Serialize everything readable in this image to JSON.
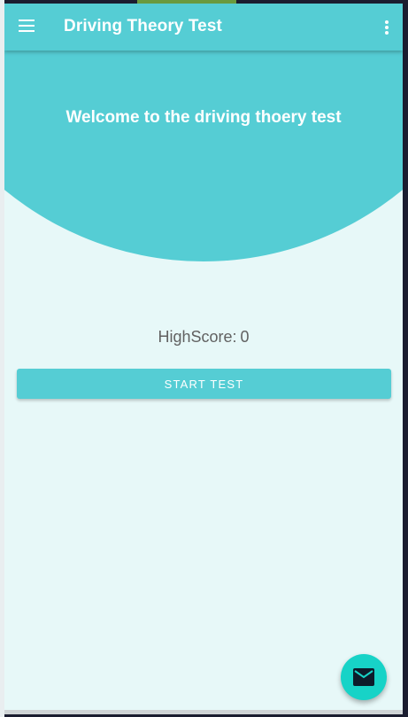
{
  "app_bar": {
    "title": "Driving Theory Test",
    "menu_icon": "hamburger-menu-icon",
    "overflow_icon": "more-vert-icon",
    "background": "#55cdd4"
  },
  "hero": {
    "welcome_text": "Welcome to the driving thoery test",
    "background": "#55cdd4"
  },
  "score": {
    "label": "HighScore:",
    "value": "0"
  },
  "actions": {
    "start_label": "START TEST"
  },
  "fab": {
    "icon": "mail-icon",
    "color": "#17d3c7"
  },
  "colors": {
    "accent": "#55cdd4",
    "screen_bg": "#e7f8f8",
    "text_secondary": "#616161"
  }
}
